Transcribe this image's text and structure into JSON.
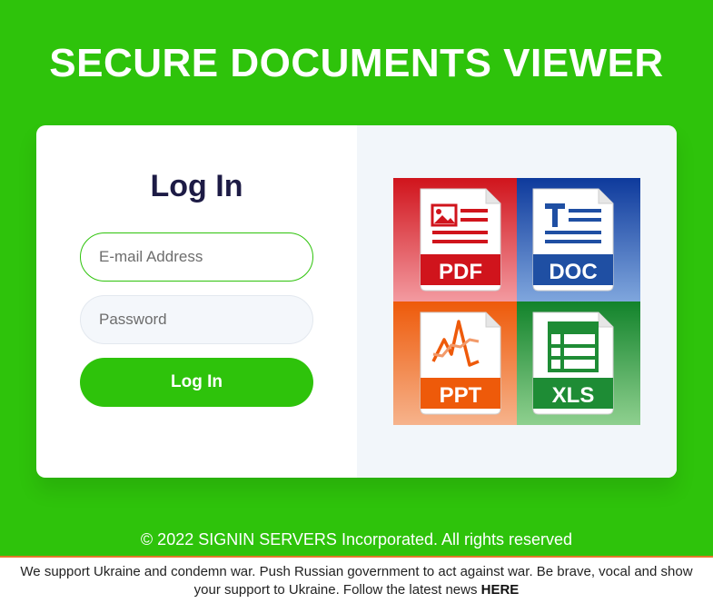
{
  "header": {
    "title": "SECURE DOCUMENTS VIEWER"
  },
  "login": {
    "heading": "Log In",
    "email_placeholder": "E-mail Address",
    "password_placeholder": "Password",
    "submit_label": "Log In"
  },
  "documents": {
    "tiles": [
      {
        "label": "PDF",
        "icon": "pdf-icon",
        "color": "#d81e25"
      },
      {
        "label": "DOC",
        "icon": "doc-icon",
        "color": "#1f4fa3"
      },
      {
        "label": "PPT",
        "icon": "ppt-icon",
        "color": "#f06014"
      },
      {
        "label": "XLS",
        "icon": "xls-icon",
        "color": "#1e8c35"
      }
    ]
  },
  "footer": {
    "copyright": "© 2022 SIGNIN SERVERS Incorporated. All rights reserved"
  },
  "banner": {
    "message": "We support Ukraine and condemn war. Push Russian government to act against war. Be brave, vocal and show your support to Ukraine. Follow the latest news ",
    "link_label": "HERE"
  },
  "colors": {
    "brand_green": "#2ec30b",
    "heading_navy": "#1d1b45"
  }
}
